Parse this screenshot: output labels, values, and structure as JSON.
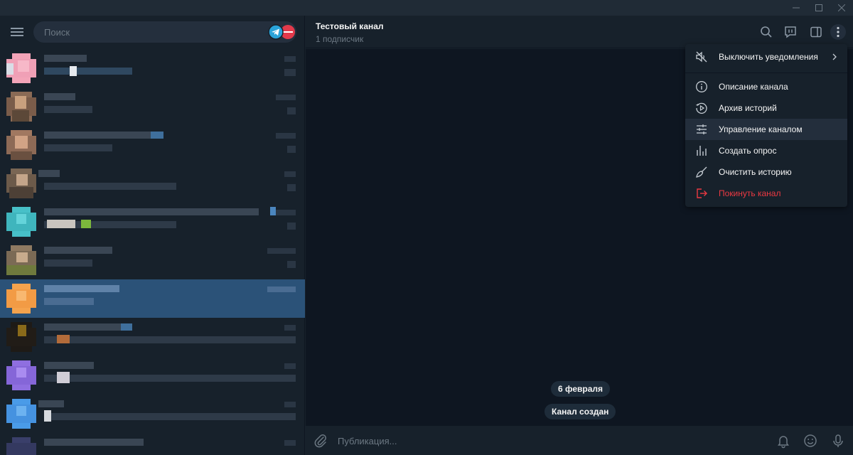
{
  "sidebar": {
    "search_placeholder": "Поиск"
  },
  "header": {
    "channel_title": "Тестовый канал",
    "subscribers": "1 подписчик"
  },
  "messages": {
    "date_badge": "6 февраля",
    "service_message": "Канал создан"
  },
  "composer": {
    "placeholder": "Публикация..."
  },
  "menu": {
    "items": [
      {
        "label": "Выключить уведомления",
        "icon": "mute-icon"
      },
      {
        "label": "Описание канала",
        "icon": "info-icon"
      },
      {
        "label": "Архив историй",
        "icon": "stories-archive-icon"
      },
      {
        "label": "Управление каналом",
        "icon": "sliders-icon"
      },
      {
        "label": "Создать опрос",
        "icon": "poll-icon"
      },
      {
        "label": "Очистить историю",
        "icon": "broom-icon"
      },
      {
        "label": "Покинуть канал",
        "icon": "leave-icon"
      }
    ]
  },
  "colors": {
    "background": "#17212b",
    "chat_area": "#0e1621",
    "accent": "#2b5278",
    "danger": "#ec3942",
    "muted": "#6c7883"
  }
}
